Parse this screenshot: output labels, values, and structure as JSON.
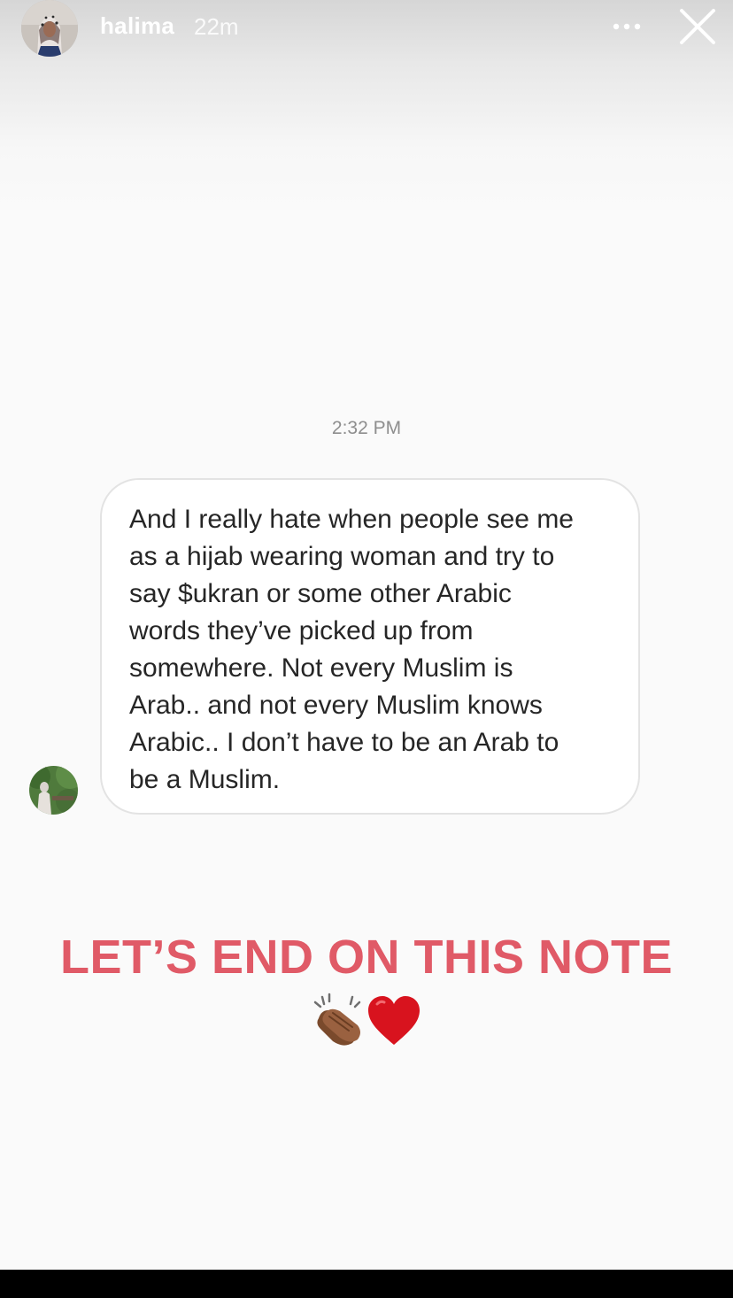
{
  "header": {
    "username": "halima",
    "time_ago": "22m",
    "more_icon": "more-dots-icon",
    "close_icon": "close-icon"
  },
  "message": {
    "timestamp": "2:32 PM",
    "lines": [
      "And I really hate when people see me",
      "as a hijab wearing woman and try to",
      "say $ukran or some other Arabic",
      "words they’ve picked up from",
      "somewhere. Not every Muslim is",
      "Arab.. and not every Muslim knows",
      "Arabic.. I don’t have to be an Arab to",
      "be a Muslim."
    ]
  },
  "caption": {
    "text": "LET’S END ON THIS NOTE",
    "color": "#e05a67",
    "emojis": [
      "clapping-hands-icon",
      "red-heart-icon"
    ]
  }
}
